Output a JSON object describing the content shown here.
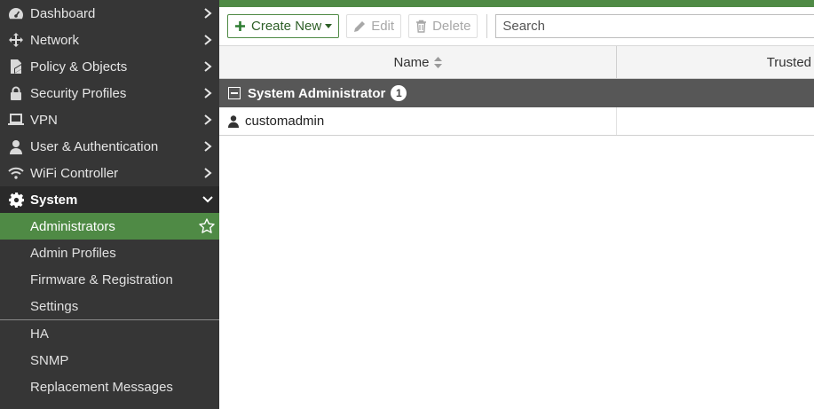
{
  "sidebar": {
    "items": [
      {
        "label": "Dashboard",
        "icon": "dashboard-icon"
      },
      {
        "label": "Network",
        "icon": "network-icon"
      },
      {
        "label": "Policy & Objects",
        "icon": "policy-icon"
      },
      {
        "label": "Security Profiles",
        "icon": "lock-icon"
      },
      {
        "label": "VPN",
        "icon": "laptop-icon"
      },
      {
        "label": "User & Authentication",
        "icon": "user-icon"
      },
      {
        "label": "WiFi Controller",
        "icon": "wifi-icon"
      }
    ],
    "system": {
      "label": "System",
      "icon": "gear-icon",
      "subitems": [
        "Administrators",
        "Admin Profiles",
        "Firmware & Registration",
        "Settings"
      ],
      "subitems2": [
        "HA",
        "SNMP",
        "Replacement Messages"
      ]
    }
  },
  "toolbar": {
    "create_label": "Create New",
    "edit_label": "Edit",
    "delete_label": "Delete",
    "search_placeholder": "Search"
  },
  "table": {
    "columns": [
      "Name",
      "Trusted"
    ],
    "group": {
      "label": "System Administrator",
      "count": "1"
    },
    "rows": [
      {
        "name": "customadmin"
      }
    ]
  },
  "colors": {
    "accent": "#4f8a45",
    "sidebar_bg": "#363636",
    "group_row_bg": "#575757"
  }
}
